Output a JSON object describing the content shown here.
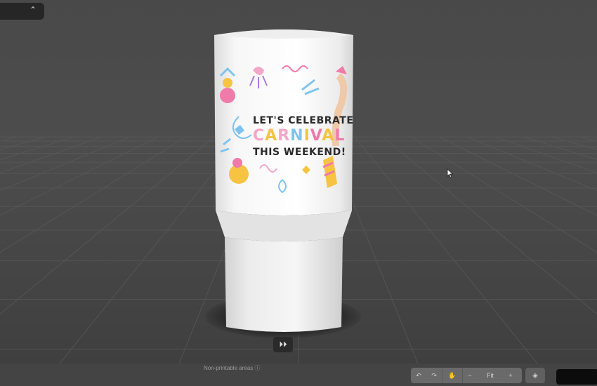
{
  "product": {
    "print_text": {
      "line1": "LET'S CELEBRATE",
      "line2_letters": [
        "C",
        "A",
        "R",
        "N",
        "I",
        "V",
        "A",
        "L"
      ],
      "line3": "THIS WEEKEND!"
    }
  },
  "top_chip": {
    "icon": "chevron-up-icon",
    "glyph": "⌃"
  },
  "play_button": {
    "icon": "fast-forward-icon",
    "glyph": "⏵⏵"
  },
  "bottom_bar": {
    "nonprintable_note": "Non-printable areas ⓘ",
    "undo_glyph": "↶",
    "redo_glyph": "↷",
    "hand_glyph": "✋",
    "zoom_out_glyph": "−",
    "zoom_value": "Fit",
    "zoom_in_glyph": "+",
    "tag_glyph": "◈"
  },
  "colors": {
    "background": "#4a4a4a",
    "tumbler": "#f4f4f4",
    "accent_pink": "#f07aa9",
    "accent_yellow": "#f6c342",
    "accent_blue": "#7fc4ef"
  }
}
